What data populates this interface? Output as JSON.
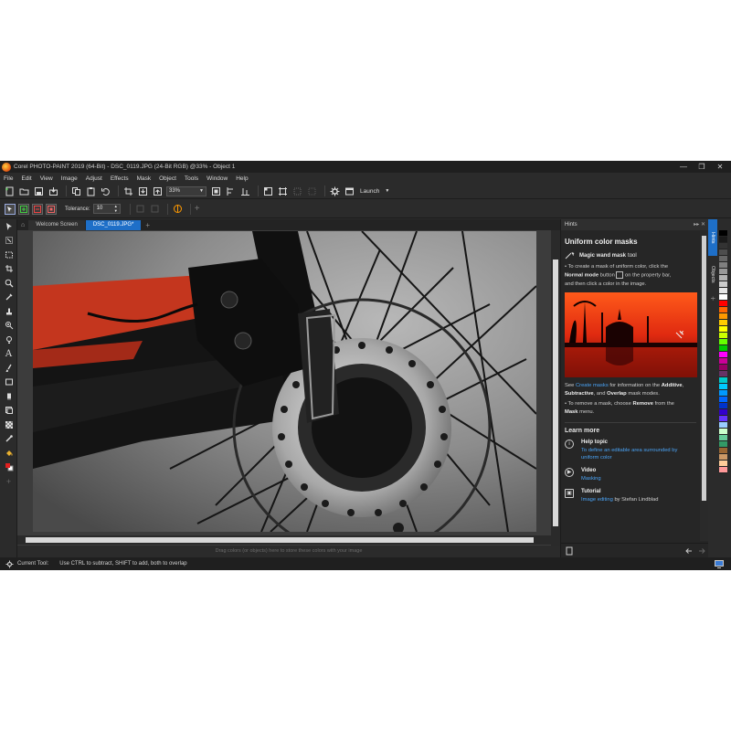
{
  "window": {
    "title": "Corel PHOTO-PAINT 2019 (64-Bit) - DSC_0119.JPG (24-Bit RGB) @33% - Object 1",
    "minimize": "—",
    "maximize": "❐",
    "close": "✕"
  },
  "menu": [
    "File",
    "Edit",
    "View",
    "Image",
    "Adjust",
    "Effects",
    "Mask",
    "Object",
    "Tools",
    "Window",
    "Help"
  ],
  "toolbar": {
    "zoom": "33%",
    "launch_label": "Launch"
  },
  "propbar": {
    "tolerance_label": "Tolerance:",
    "tolerance_value": "10"
  },
  "tabs": [
    {
      "label": "Welcome Screen",
      "active": false
    },
    {
      "label": "DSC_0119.JPG*",
      "active": true
    }
  ],
  "canvas_hint": "Drag colors (or objects) here to store these colors with your image",
  "status": {
    "tool_label": "Current Tool:",
    "message": "Use CTRL to subtract, SHIFT to add, both to overlap"
  },
  "hints": {
    "panel_title": "Hints",
    "title": "Uniform color masks",
    "tool_name": "Magic wand mask",
    "tool_suffix": "tool",
    "step1_a": "• To create a mask of uniform color, click the",
    "step1_b": "Normal mode",
    "step1_c": "button",
    "step1_d": "on the property bar,",
    "step1_e": "and then click a color in the image.",
    "see_a": "See",
    "see_link": "Create masks",
    "see_b": "for information on the",
    "additive": "Additive",
    "subtractive": "Subtractive",
    "and": ", and",
    "overlap": "Overlap",
    "see_c": "mask modes.",
    "remove_a": "• To remove a mask, choose",
    "remove_b": "Remove",
    "remove_c": "from the",
    "remove_menu": "Mask",
    "remove_d": "menu.",
    "learn_more": "Learn more",
    "help_topic": "Help topic",
    "help_link": "To define an editable area surrounded by uniform color",
    "video": "Video",
    "video_link": "Masking",
    "tutorial": "Tutorial",
    "tutorial_link": "Image editing",
    "tutorial_by": "by Stefan Lindblad"
  },
  "dockers": [
    "Hints",
    "Objects"
  ],
  "palette_colors": [
    "#000000",
    "#1a1a1a",
    "#333333",
    "#4d4d4d",
    "#666666",
    "#808080",
    "#999999",
    "#b3b3b3",
    "#cccccc",
    "#e6e6e6",
    "#ffffff",
    "#ff0000",
    "#ff6600",
    "#ff9900",
    "#ffcc00",
    "#ffff00",
    "#ccff00",
    "#66ff00",
    "#00cc00",
    "#ff00ff",
    "#cc0099",
    "#990066",
    "#663366",
    "#00cccc",
    "#00ccff",
    "#0099ff",
    "#0066ff",
    "#0033cc",
    "#3300cc",
    "#6633ff",
    "#99ccff",
    "#ccffcc",
    "#66cc99",
    "#339966",
    "#996633",
    "#cc9966",
    "#ffcc99",
    "#ff9999"
  ],
  "colors": {
    "accent": "#1e6fc8",
    "link": "#4aa3f5"
  }
}
